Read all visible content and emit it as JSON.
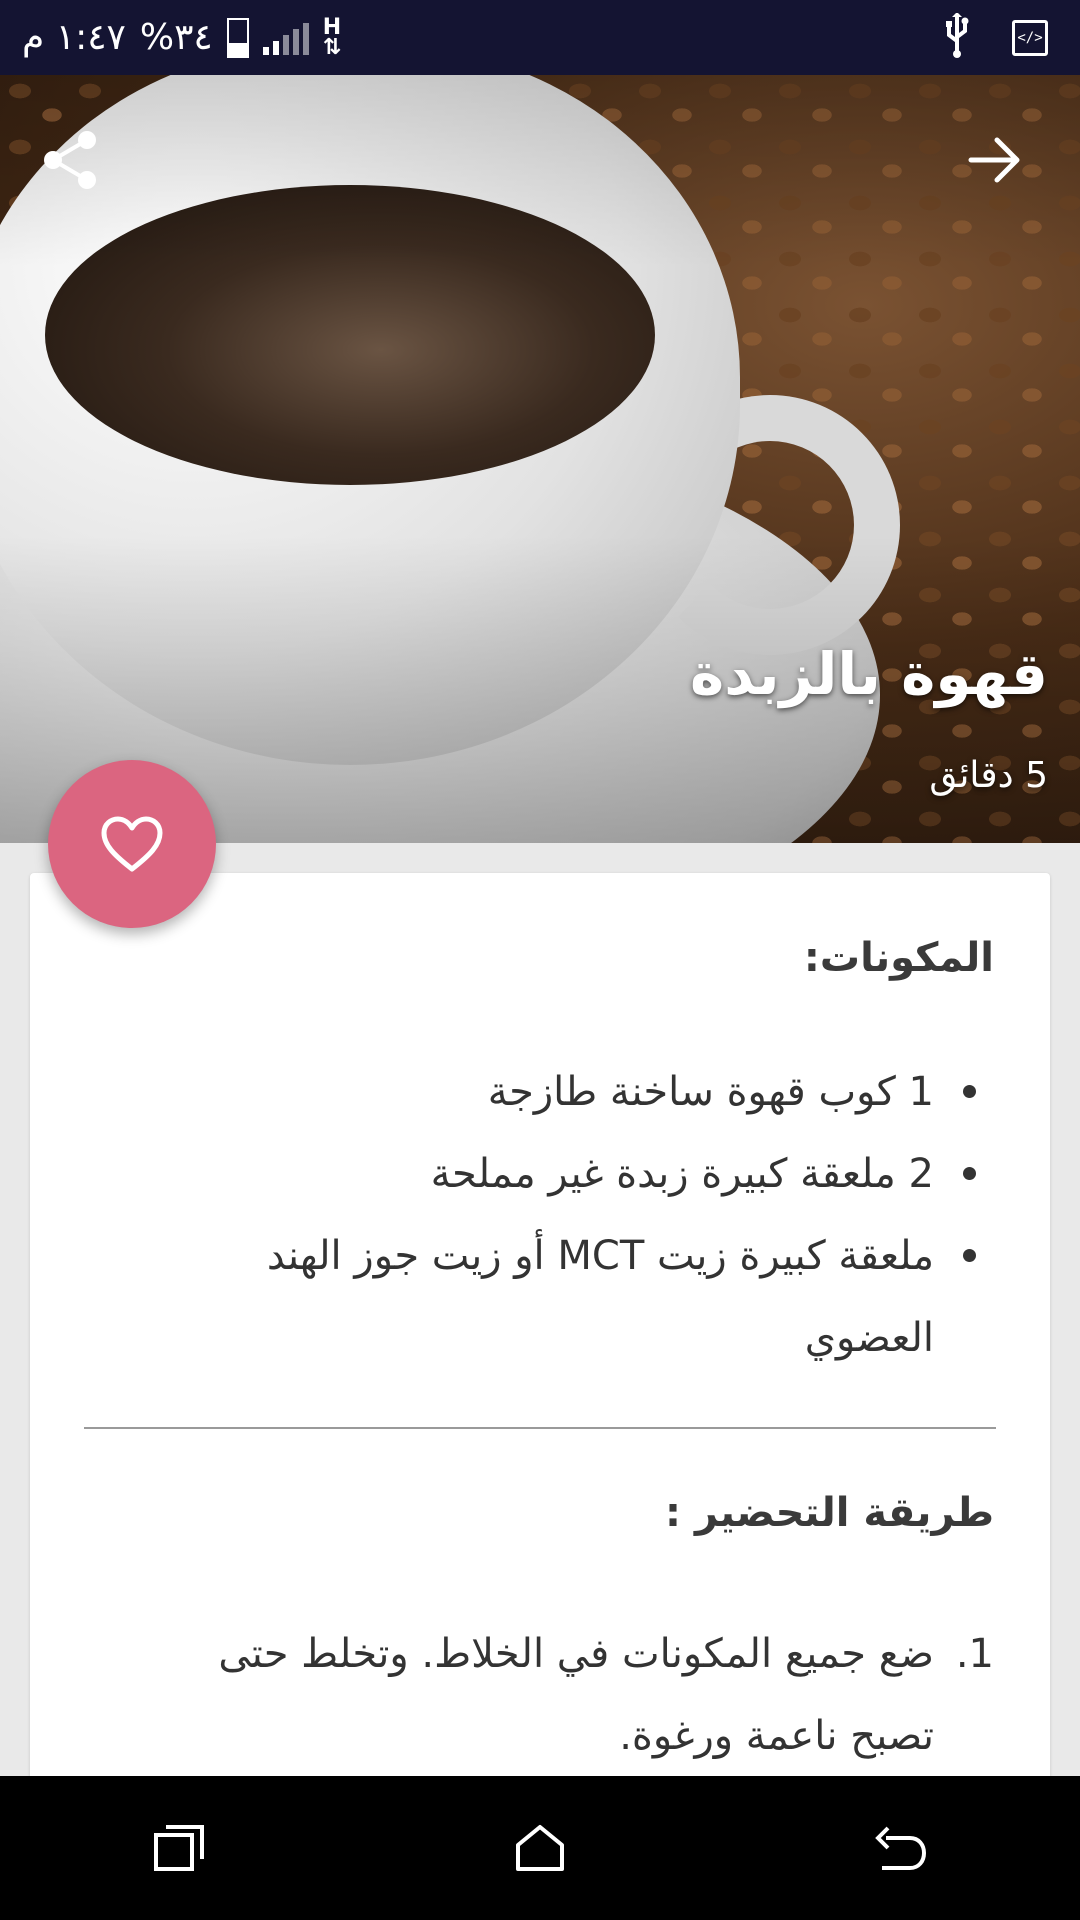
{
  "status_bar": {
    "time": "١:٤٧ م",
    "battery_percent": "%٣٤",
    "network": "H",
    "icons": [
      "usb-icon",
      "developer-icon",
      "battery-icon",
      "signal-icon"
    ]
  },
  "hero": {
    "title": "قهوة بالزبدة",
    "duration": "5 دقائق",
    "icons": {
      "share": "share-icon",
      "back": "arrow-right-icon"
    }
  },
  "favorite": {
    "icon": "heart-icon",
    "color": "#db6580"
  },
  "ingredients": {
    "title": "المكونات:",
    "items": [
      "1 كوب قهوة ساخنة طازجة",
      "2 ملعقة كبيرة زبدة غير مملحة",
      "ملعقة كبيرة زيت MCT أو زيت جوز الهند العضوي"
    ]
  },
  "preparation": {
    "title": "طريقة التحضير :",
    "steps": [
      {
        "number": "1.",
        "text": "ضع جميع المكونات في الخلاط. وتخلط حتى تصبح ناعمة ورغوة."
      }
    ]
  },
  "nav_bar": {
    "icons": [
      "recents-icon",
      "home-icon",
      "back-icon"
    ]
  }
}
